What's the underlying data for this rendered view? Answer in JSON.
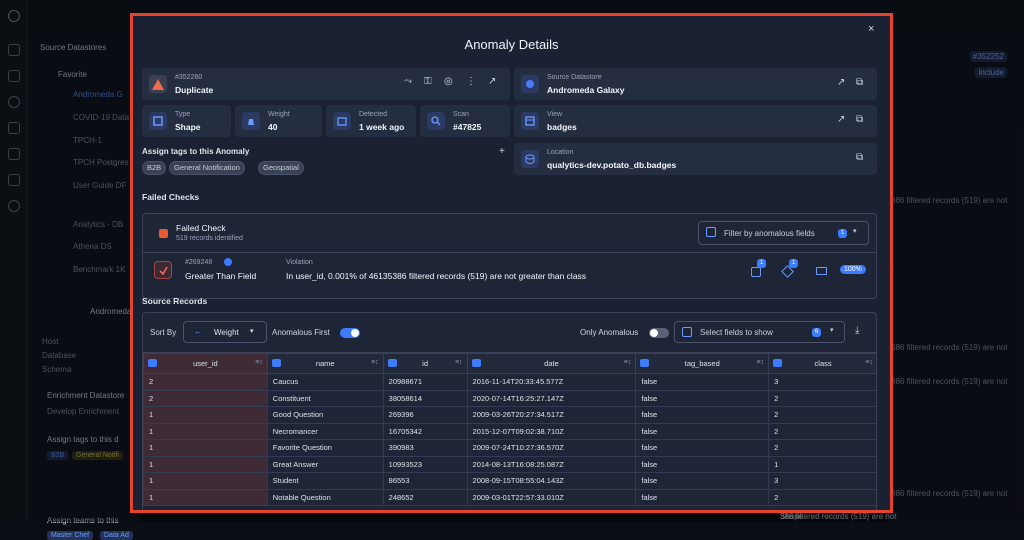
{
  "background": {
    "left_panel": {
      "section": "Source Datastores",
      "favorite": "Favorite",
      "items": [
        "Andromeda G",
        "COVID-19 Data",
        "TPCH-1",
        "TPCH Postgres",
        "User Guide DF",
        "Analytics - DB",
        "Athena DS",
        "Benchmark 1K"
      ],
      "selected_name": "Andromeda",
      "fields": [
        "Host",
        "Database",
        "Schema"
      ],
      "enrichment_title": "Enrichment Datastore",
      "enrichment_value": "Develop Enrichment",
      "assign_tags": "Assign tags to this d",
      "tags": [
        "B2B",
        "General Notifi"
      ],
      "assign_teams": "Assign teams to this",
      "teams": [
        "Master Chef",
        "Data Ad"
      ]
    },
    "right_panel": {
      "id_badge": "#352252",
      "include": "Include",
      "snippet1": "386 filtered records (519) are not",
      "snippet2": "386 filtered records (519) are not",
      "snippet3": "386 filtered records (519) are not",
      "snippet4": "386 filtered records (519) are not",
      "shape": "Shape"
    }
  },
  "modal": {
    "title": "Anomaly Details",
    "close": "×",
    "anomaly": {
      "id": "#352260",
      "type_label": "Duplicate"
    },
    "datastore": {
      "label": "Source Datastore",
      "value": "Andromeda Galaxy"
    },
    "type": {
      "label": "Type",
      "value": "Shape"
    },
    "weight": {
      "label": "Weight",
      "value": "40"
    },
    "detected": {
      "label": "Detected",
      "value": "1 week ago"
    },
    "scan": {
      "label": "Scan",
      "value": "#47825"
    },
    "view": {
      "label": "View",
      "value": "badges"
    },
    "location": {
      "label": "Location",
      "value": "qualytics-dev.potato_db.badges"
    },
    "assign_tags": {
      "label": "Assign tags to this Anomaly",
      "add": "+",
      "tags": [
        "B2B",
        "General Notification",
        "Geospatial"
      ]
    },
    "failed_checks": {
      "section": "Failed Checks",
      "summary_title": "Failed Check",
      "summary_sub": "519 records identified",
      "filter_label": "Filter by anomalous fields",
      "filter_count": "1",
      "check_id": "#269248",
      "check_name": "Greater Than Field",
      "violation_label": "Violation",
      "violation_text": "In user_id, 0.001% of 46135386 filtered records (519) are not greater than class",
      "badge1": "1",
      "badge2": "1",
      "percent": "100%"
    },
    "source_records": {
      "section": "Source Records",
      "sort_by": "Sort By",
      "sort_value": "Weight",
      "anomalous_first": "Anomalous First",
      "only_anomalous": "Only Anomalous",
      "select_fields": "Select fields to show",
      "fields_count": "6",
      "columns": [
        "user_id",
        "name",
        "id",
        "date",
        "tag_based",
        "class"
      ],
      "rows": [
        [
          "2",
          "Caucus",
          "20988671",
          "2016-11-14T20:33:45.577Z",
          "false",
          "3"
        ],
        [
          "2",
          "Constituent",
          "38058614",
          "2020-07-14T16:25:27.147Z",
          "false",
          "2"
        ],
        [
          "1",
          "Good Question",
          "269396",
          "2009-03-26T20:27:34.517Z",
          "false",
          "2"
        ],
        [
          "1",
          "Necromancer",
          "16705342",
          "2015-12-07T09:02:38.710Z",
          "false",
          "2"
        ],
        [
          "1",
          "Favorite Question",
          "390983",
          "2009-07-24T10:27:36.570Z",
          "false",
          "2"
        ],
        [
          "1",
          "Great Answer",
          "10993523",
          "2014-08-13T16:08:25.087Z",
          "false",
          "1"
        ],
        [
          "1",
          "Student",
          "86553",
          "2008-09-15T08:55:04.143Z",
          "false",
          "3"
        ],
        [
          "1",
          "Notable Question",
          "248652",
          "2009-03-01T22:57:33.010Z",
          "false",
          "2"
        ]
      ]
    }
  }
}
